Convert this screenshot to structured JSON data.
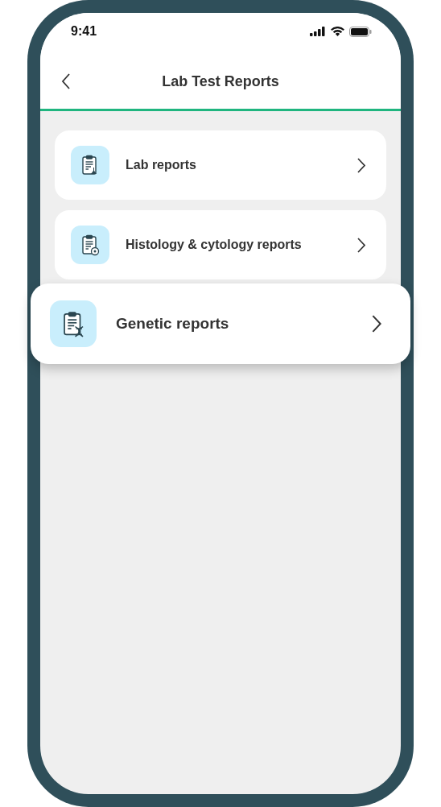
{
  "status_bar": {
    "time": "9:41"
  },
  "header": {
    "title": "Lab Test Reports"
  },
  "items": [
    {
      "label": "Lab reports",
      "kind": "lab",
      "highlighted": false
    },
    {
      "label": "Histology & cytology reports",
      "kind": "histology",
      "highlighted": false
    },
    {
      "label": "Genetic reports",
      "kind": "genetic",
      "highlighted": true
    }
  ]
}
